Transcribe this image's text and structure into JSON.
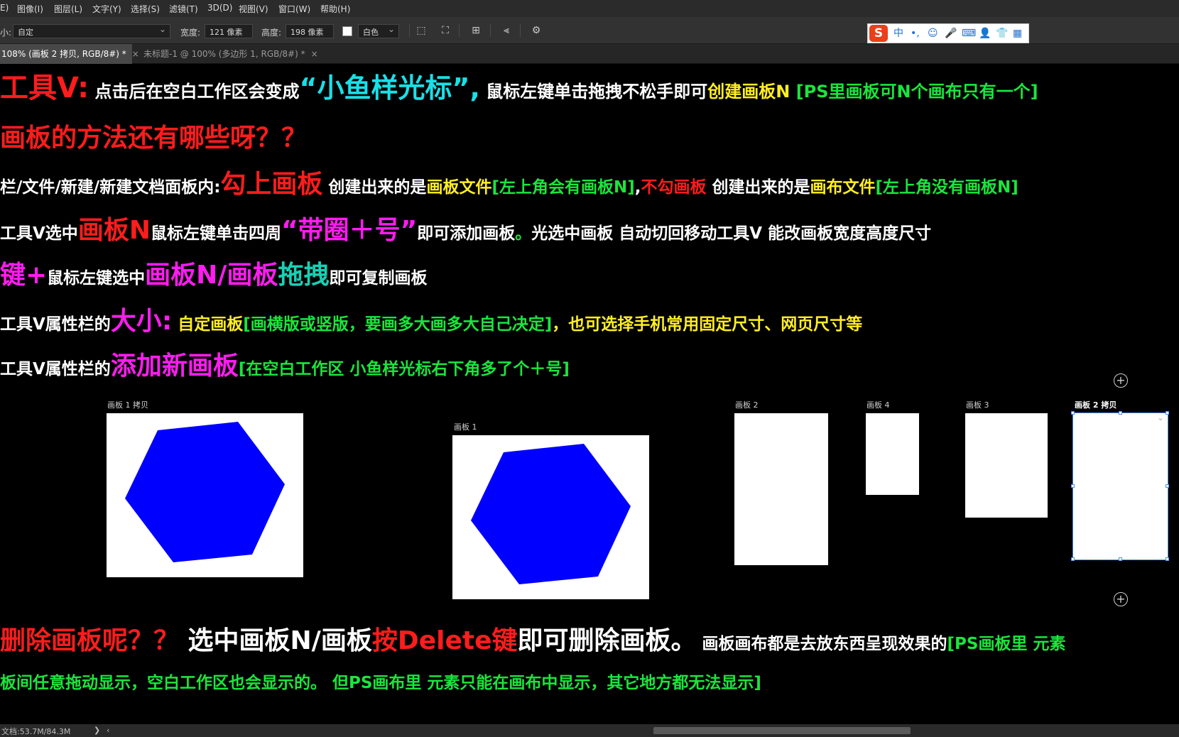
{
  "menu": [
    "E)",
    "图像(I)",
    "图层(L)",
    "文字(Y)",
    "选择(S)",
    "滤镜(T)",
    "3D(D)",
    "视图(V)",
    "窗口(W)",
    "帮助(H)"
  ],
  "options_bar": {
    "size_prefix": "小:",
    "size_value": "自定",
    "width_label": "宽度:",
    "width_value": "121 像素",
    "height_label": "高度:",
    "height_value": "198 像素",
    "color_value": "白色"
  },
  "ime": {
    "logo": "S",
    "mode": "中",
    "items": [
      "•,",
      "☺",
      "🎤",
      "⌨",
      "👤",
      "👕",
      "▦"
    ]
  },
  "tabs": [
    {
      "label": "108% (画板 2 拷贝, RGB/8#) *",
      "close": "×"
    },
    {
      "label": "未标题-1 @ 100% (多边形 1, RGB/8#) *",
      "close": "×"
    }
  ],
  "lines": {
    "l1": {
      "a": "工具V:",
      "b": " 点击后在空白工作区会变成",
      "c": "“小鱼样光标”,",
      "d": " 鼠标左键单击拖拽不松手即可",
      "e": "创建画板N",
      "f": " [PS里画板可N个画布只有一个]"
    },
    "l2": {
      "a": "画板的方法还有哪些呀？？"
    },
    "l3": {
      "a": "栏/文件/新建/新建文档面板内:",
      "b": "勾上画板",
      "c": " 创建出来的是",
      "d": "画板文件",
      "e": "[左上角会有画板N]",
      "f": ",",
      "g": "不勾画板",
      "h": " 创建出来的是",
      "i": "画布文件",
      "j": "[左上角没有画板N]"
    },
    "l4": {
      "a": "工具V选中",
      "b": "画板N",
      "c": "鼠标左键单击四周",
      "d": "“带圈＋号”",
      "e": "即可添加画板",
      "f": "。",
      "g": "光选中画板 自动切回移动工具V 能改画板宽度高度尺寸"
    },
    "l5": {
      "a": "键+",
      "b": "鼠标左键选中",
      "c": "画板N/画板",
      "d": "拖拽",
      "e": "即可复制画板"
    },
    "l6": {
      "a": "工具V属性栏的",
      "b": "大小:",
      "c": " 自定画板",
      "d": "[画横版或竖版，要画多大画多大自己决定]",
      "e": "，也可选择手机常用固定尺寸、网页尺寸等"
    },
    "l7": {
      "a": "工具V属性栏的",
      "b": "添加新画板",
      "c": "[在空白工作区 小鱼样光标右下角多了个＋号]"
    },
    "l8": {
      "a": "删除画板呢？？",
      "b": " 选中画板N/画板",
      "c": "按Delete键",
      "d": "即可删除画板。",
      "e": " 画板画布都是去放东西呈现效果的",
      "f": "[PS画板里  元素"
    },
    "l9": {
      "a": "板间任意拖动显示，空白工作区也会显示的。",
      "b": "  但PS画布里   元素只能在画布中显示，其它地方都无法显示]"
    }
  },
  "artboards": [
    {
      "label": "画板 1 拷贝"
    },
    {
      "label": "画板 1"
    },
    {
      "label": "画板 2"
    },
    {
      "label": "画板 4"
    },
    {
      "label": "画板 3"
    },
    {
      "label": "画板 2 拷贝"
    }
  ],
  "plus_glyph": "+",
  "status": {
    "doc": "文档:53.7M/84.3M",
    "arrow": "❯",
    "arrow2": "‹"
  },
  "colors": {
    "hexagon": "#0000ff",
    "selection": "#4a8ef0"
  }
}
